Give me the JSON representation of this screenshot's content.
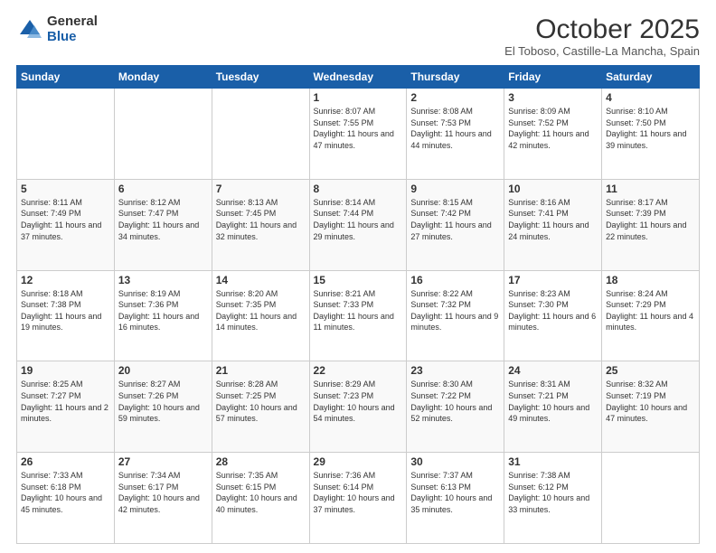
{
  "logo": {
    "general": "General",
    "blue": "Blue"
  },
  "title": "October 2025",
  "location": "El Toboso, Castille-La Mancha, Spain",
  "days_of_week": [
    "Sunday",
    "Monday",
    "Tuesday",
    "Wednesday",
    "Thursday",
    "Friday",
    "Saturday"
  ],
  "weeks": [
    [
      {
        "day": "",
        "info": ""
      },
      {
        "day": "",
        "info": ""
      },
      {
        "day": "",
        "info": ""
      },
      {
        "day": "1",
        "info": "Sunrise: 8:07 AM\nSunset: 7:55 PM\nDaylight: 11 hours and 47 minutes."
      },
      {
        "day": "2",
        "info": "Sunrise: 8:08 AM\nSunset: 7:53 PM\nDaylight: 11 hours and 44 minutes."
      },
      {
        "day": "3",
        "info": "Sunrise: 8:09 AM\nSunset: 7:52 PM\nDaylight: 11 hours and 42 minutes."
      },
      {
        "day": "4",
        "info": "Sunrise: 8:10 AM\nSunset: 7:50 PM\nDaylight: 11 hours and 39 minutes."
      }
    ],
    [
      {
        "day": "5",
        "info": "Sunrise: 8:11 AM\nSunset: 7:49 PM\nDaylight: 11 hours and 37 minutes."
      },
      {
        "day": "6",
        "info": "Sunrise: 8:12 AM\nSunset: 7:47 PM\nDaylight: 11 hours and 34 minutes."
      },
      {
        "day": "7",
        "info": "Sunrise: 8:13 AM\nSunset: 7:45 PM\nDaylight: 11 hours and 32 minutes."
      },
      {
        "day": "8",
        "info": "Sunrise: 8:14 AM\nSunset: 7:44 PM\nDaylight: 11 hours and 29 minutes."
      },
      {
        "day": "9",
        "info": "Sunrise: 8:15 AM\nSunset: 7:42 PM\nDaylight: 11 hours and 27 minutes."
      },
      {
        "day": "10",
        "info": "Sunrise: 8:16 AM\nSunset: 7:41 PM\nDaylight: 11 hours and 24 minutes."
      },
      {
        "day": "11",
        "info": "Sunrise: 8:17 AM\nSunset: 7:39 PM\nDaylight: 11 hours and 22 minutes."
      }
    ],
    [
      {
        "day": "12",
        "info": "Sunrise: 8:18 AM\nSunset: 7:38 PM\nDaylight: 11 hours and 19 minutes."
      },
      {
        "day": "13",
        "info": "Sunrise: 8:19 AM\nSunset: 7:36 PM\nDaylight: 11 hours and 16 minutes."
      },
      {
        "day": "14",
        "info": "Sunrise: 8:20 AM\nSunset: 7:35 PM\nDaylight: 11 hours and 14 minutes."
      },
      {
        "day": "15",
        "info": "Sunrise: 8:21 AM\nSunset: 7:33 PM\nDaylight: 11 hours and 11 minutes."
      },
      {
        "day": "16",
        "info": "Sunrise: 8:22 AM\nSunset: 7:32 PM\nDaylight: 11 hours and 9 minutes."
      },
      {
        "day": "17",
        "info": "Sunrise: 8:23 AM\nSunset: 7:30 PM\nDaylight: 11 hours and 6 minutes."
      },
      {
        "day": "18",
        "info": "Sunrise: 8:24 AM\nSunset: 7:29 PM\nDaylight: 11 hours and 4 minutes."
      }
    ],
    [
      {
        "day": "19",
        "info": "Sunrise: 8:25 AM\nSunset: 7:27 PM\nDaylight: 11 hours and 2 minutes."
      },
      {
        "day": "20",
        "info": "Sunrise: 8:27 AM\nSunset: 7:26 PM\nDaylight: 10 hours and 59 minutes."
      },
      {
        "day": "21",
        "info": "Sunrise: 8:28 AM\nSunset: 7:25 PM\nDaylight: 10 hours and 57 minutes."
      },
      {
        "day": "22",
        "info": "Sunrise: 8:29 AM\nSunset: 7:23 PM\nDaylight: 10 hours and 54 minutes."
      },
      {
        "day": "23",
        "info": "Sunrise: 8:30 AM\nSunset: 7:22 PM\nDaylight: 10 hours and 52 minutes."
      },
      {
        "day": "24",
        "info": "Sunrise: 8:31 AM\nSunset: 7:21 PM\nDaylight: 10 hours and 49 minutes."
      },
      {
        "day": "25",
        "info": "Sunrise: 8:32 AM\nSunset: 7:19 PM\nDaylight: 10 hours and 47 minutes."
      }
    ],
    [
      {
        "day": "26",
        "info": "Sunrise: 7:33 AM\nSunset: 6:18 PM\nDaylight: 10 hours and 45 minutes."
      },
      {
        "day": "27",
        "info": "Sunrise: 7:34 AM\nSunset: 6:17 PM\nDaylight: 10 hours and 42 minutes."
      },
      {
        "day": "28",
        "info": "Sunrise: 7:35 AM\nSunset: 6:15 PM\nDaylight: 10 hours and 40 minutes."
      },
      {
        "day": "29",
        "info": "Sunrise: 7:36 AM\nSunset: 6:14 PM\nDaylight: 10 hours and 37 minutes."
      },
      {
        "day": "30",
        "info": "Sunrise: 7:37 AM\nSunset: 6:13 PM\nDaylight: 10 hours and 35 minutes."
      },
      {
        "day": "31",
        "info": "Sunrise: 7:38 AM\nSunset: 6:12 PM\nDaylight: 10 hours and 33 minutes."
      },
      {
        "day": "",
        "info": ""
      }
    ]
  ]
}
